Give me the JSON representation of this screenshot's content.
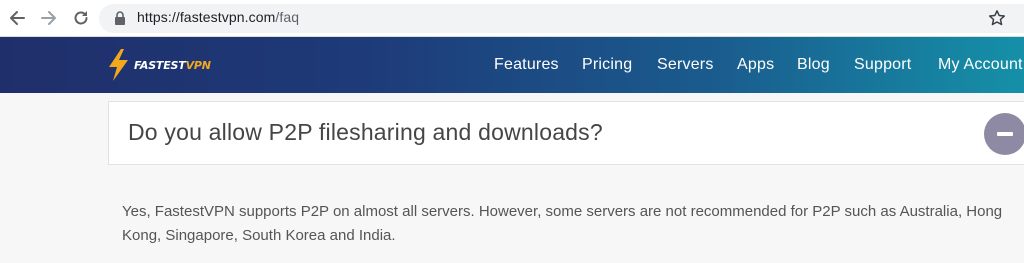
{
  "browser": {
    "url_host": "https://fastestvpn.com",
    "url_path": "/faq"
  },
  "site": {
    "logo_text_main": "FASTEST",
    "logo_text_accent": "VPN",
    "nav": [
      "Features",
      "Pricing",
      "Servers",
      "Apps",
      "Blog",
      "Support",
      "My Account"
    ]
  },
  "faq": {
    "question": "Do you allow P2P filesharing and downloads?",
    "answer": "Yes, FastestVPN supports P2P on almost all servers. However, some servers are not recommended for P2P such as Australia, Hong Kong, Singapore, South Korea and India."
  },
  "colors": {
    "header_start": "#1f2f6b",
    "header_end": "#1590a8",
    "logo_accent": "#f2a81d",
    "toggle": "#8e8aa3"
  }
}
